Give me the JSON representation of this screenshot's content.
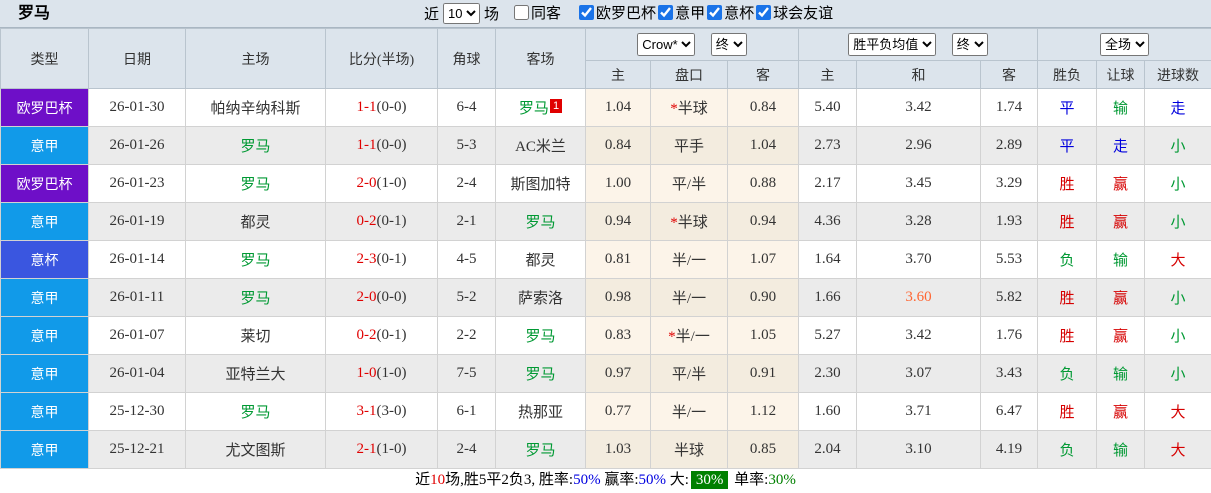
{
  "header": {
    "title": "罗马",
    "near_label": "近",
    "matches_count": "10",
    "matches_unit": "场",
    "checkbox_accent_color": "#1a73e8",
    "filters": [
      {
        "label": "同客",
        "checked": false
      },
      {
        "label": "欧罗巴杯",
        "checked": true
      },
      {
        "label": "意甲",
        "checked": true
      },
      {
        "label": "意杯",
        "checked": true
      },
      {
        "label": "球会友谊",
        "checked": true
      }
    ]
  },
  "selects": {
    "company": "Crow*",
    "company_state": "终",
    "avg": "胜平负均值",
    "avg_state": "终",
    "scope": "全场"
  },
  "table": {
    "columns": [
      "类型",
      "日期",
      "主场",
      "比分(半场)",
      "角球",
      "客场",
      "主",
      "盘口",
      "客",
      "主",
      "和",
      "客",
      "胜负",
      "让球",
      "进球数"
    ],
    "league_colors": {
      "欧罗巴杯": "#6e0fc8",
      "意甲": "#119ae9",
      "意杯": "#3a56e0"
    },
    "roma_color": "#009933",
    "rows": [
      {
        "league": "欧罗巴杯",
        "date": "26-01-30",
        "home": "帕纳辛纳科斯",
        "home_roma": false,
        "score": "1-1",
        "half": "(0-0)",
        "corners": "6-4",
        "away": "罗马",
        "away_roma": true,
        "away_badge": "1",
        "odds": [
          "1.04",
          "*半球",
          "0.84"
        ],
        "avg": [
          "5.40",
          "3.42",
          "1.74"
        ],
        "results": [
          {
            "t": "平",
            "c": "blue"
          },
          {
            "t": "输",
            "c": "green"
          },
          {
            "t": "走",
            "c": "blue"
          }
        ]
      },
      {
        "league": "意甲",
        "date": "26-01-26",
        "home": "罗马",
        "home_roma": true,
        "score": "1-1",
        "half": "(0-0)",
        "corners": "5-3",
        "away": "AC米兰",
        "away_roma": false,
        "away_badge": "",
        "odds": [
          "0.84",
          "平手",
          "1.04"
        ],
        "avg": [
          "2.73",
          "2.96",
          "2.89"
        ],
        "results": [
          {
            "t": "平",
            "c": "blue"
          },
          {
            "t": "走",
            "c": "blue"
          },
          {
            "t": "小",
            "c": "green"
          }
        ]
      },
      {
        "league": "欧罗巴杯",
        "date": "26-01-23",
        "home": "罗马",
        "home_roma": true,
        "score": "2-0",
        "half": "(1-0)",
        "corners": "2-4",
        "away": "斯图加特",
        "away_roma": false,
        "away_badge": "",
        "odds": [
          "1.00",
          "平/半",
          "0.88"
        ],
        "avg": [
          "2.17",
          "3.45",
          "3.29"
        ],
        "results": [
          {
            "t": "胜",
            "c": "red"
          },
          {
            "t": "赢",
            "c": "red"
          },
          {
            "t": "小",
            "c": "green"
          }
        ]
      },
      {
        "league": "意甲",
        "date": "26-01-19",
        "home": "都灵",
        "home_roma": false,
        "score": "0-2",
        "half": "(0-1)",
        "corners": "2-1",
        "away": "罗马",
        "away_roma": true,
        "away_badge": "",
        "odds": [
          "0.94",
          "*半球",
          "0.94"
        ],
        "avg": [
          "4.36",
          "3.28",
          "1.93"
        ],
        "results": [
          {
            "t": "胜",
            "c": "red"
          },
          {
            "t": "赢",
            "c": "red"
          },
          {
            "t": "小",
            "c": "green"
          }
        ]
      },
      {
        "league": "意杯",
        "date": "26-01-14",
        "home": "罗马",
        "home_roma": true,
        "score": "2-3",
        "half": "(0-1)",
        "corners": "4-5",
        "away": "都灵",
        "away_roma": false,
        "away_badge": "",
        "odds": [
          "0.81",
          "半/一",
          "1.07"
        ],
        "avg": [
          "1.64",
          "3.70",
          "5.53"
        ],
        "results": [
          {
            "t": "负",
            "c": "green"
          },
          {
            "t": "输",
            "c": "green"
          },
          {
            "t": "大",
            "c": "red"
          }
        ]
      },
      {
        "league": "意甲",
        "date": "26-01-11",
        "home": "罗马",
        "home_roma": true,
        "score": "2-0",
        "half": "(0-0)",
        "corners": "5-2",
        "away": "萨索洛",
        "away_roma": false,
        "away_badge": "",
        "odds": [
          "0.98",
          "半/一",
          "0.90"
        ],
        "avg": [
          "1.66",
          "3.60",
          "5.82"
        ],
        "avg_hot": 1,
        "results": [
          {
            "t": "胜",
            "c": "red"
          },
          {
            "t": "赢",
            "c": "red"
          },
          {
            "t": "小",
            "c": "green"
          }
        ]
      },
      {
        "league": "意甲",
        "date": "26-01-07",
        "home": "莱切",
        "home_roma": false,
        "score": "0-2",
        "half": "(0-1)",
        "corners": "2-2",
        "away": "罗马",
        "away_roma": true,
        "away_badge": "",
        "odds": [
          "0.83",
          "*半/一",
          "1.05"
        ],
        "avg": [
          "5.27",
          "3.42",
          "1.76"
        ],
        "results": [
          {
            "t": "胜",
            "c": "red"
          },
          {
            "t": "赢",
            "c": "red"
          },
          {
            "t": "小",
            "c": "green"
          }
        ]
      },
      {
        "league": "意甲",
        "date": "26-01-04",
        "home": "亚特兰大",
        "home_roma": false,
        "score": "1-0",
        "half": "(1-0)",
        "corners": "7-5",
        "away": "罗马",
        "away_roma": true,
        "away_badge": "",
        "odds": [
          "0.97",
          "平/半",
          "0.91"
        ],
        "avg": [
          "2.30",
          "3.07",
          "3.43"
        ],
        "results": [
          {
            "t": "负",
            "c": "green"
          },
          {
            "t": "输",
            "c": "green"
          },
          {
            "t": "小",
            "c": "green"
          }
        ]
      },
      {
        "league": "意甲",
        "date": "25-12-30",
        "home": "罗马",
        "home_roma": true,
        "score": "3-1",
        "half": "(3-0)",
        "corners": "6-1",
        "away": "热那亚",
        "away_roma": false,
        "away_badge": "",
        "odds": [
          "0.77",
          "半/一",
          "1.12"
        ],
        "avg": [
          "1.60",
          "3.71",
          "6.47"
        ],
        "results": [
          {
            "t": "胜",
            "c": "red"
          },
          {
            "t": "赢",
            "c": "red"
          },
          {
            "t": "大",
            "c": "red"
          }
        ]
      },
      {
        "league": "意甲",
        "date": "25-12-21",
        "home": "尤文图斯",
        "home_roma": false,
        "score": "2-1",
        "half": "(1-0)",
        "corners": "2-4",
        "away": "罗马",
        "away_roma": true,
        "away_badge": "",
        "odds": [
          "1.03",
          "半球",
          "0.85"
        ],
        "avg": [
          "2.04",
          "3.10",
          "4.19"
        ],
        "results": [
          {
            "t": "负",
            "c": "green"
          },
          {
            "t": "输",
            "c": "green"
          },
          {
            "t": "大",
            "c": "red"
          }
        ]
      }
    ]
  },
  "footer": {
    "seg_near": "近",
    "seg_count": "10",
    "seg_stats": "场,胜5平2负3, 胜率:",
    "win_rate": "50%",
    "seg_odds": " 赢率:",
    "odds_rate": "50%",
    "seg_big": " 大:",
    "big_rate": "30%",
    "seg_single": " 单率:",
    "single_rate": "30%"
  }
}
